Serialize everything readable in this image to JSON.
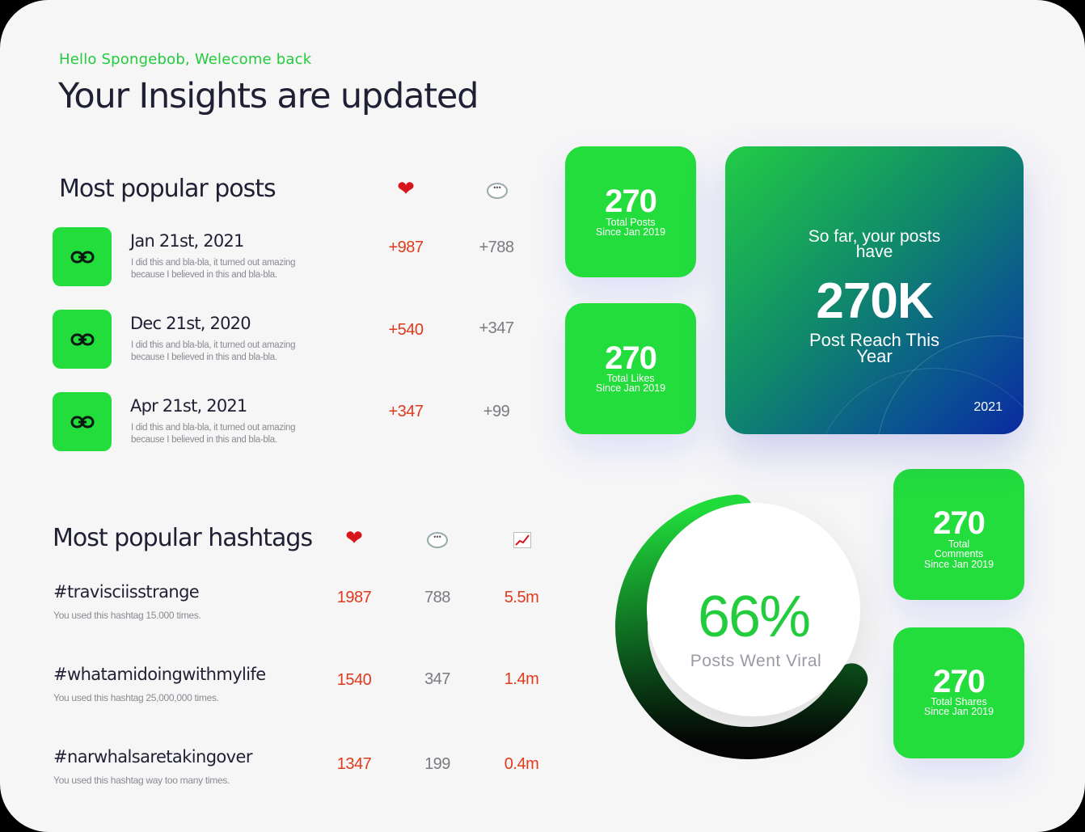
{
  "greeting": "Hello Spongebob, Welecome back",
  "headline": "Your Insights are updated",
  "popular_posts": {
    "title": "Most popular posts",
    "likes_icon": "heart-icon",
    "comments_icon": "speech-bubble-icon",
    "items": [
      {
        "date": "Jan 21st, 2021",
        "desc": "I did this and bla-bla, it turned out amazing because I believed in this and bla-bla.",
        "likes": "+987",
        "comments": "+788"
      },
      {
        "date": "Dec 21st, 2020",
        "desc": "I did this and bla-bla, it turned out amazing because I believed in this and bla-bla.",
        "likes": "+540",
        "comments": "+347"
      },
      {
        "date": "Apr 21st, 2021",
        "desc": "I did this and bla-bla, it turned out amazing because I believed in this and bla-bla.",
        "likes": "+347",
        "comments": "+99"
      }
    ]
  },
  "popular_hashtags": {
    "title": "Most popular hashtags",
    "icons": [
      "heart-icon",
      "speech-bubble-icon",
      "trending-chart-icon"
    ],
    "items": [
      {
        "tag": "#travisciisstrange",
        "desc": "You used this hashtag 15.000 times.",
        "likes": "1987",
        "comments": "788",
        "reach": "5.5m"
      },
      {
        "tag": "#whatamidoingwithmylife",
        "desc": "You used this hashtag 25,000,000 times.",
        "likes": "1540",
        "comments": "347",
        "reach": "1.4m"
      },
      {
        "tag": "#narwhalsaretakingover",
        "desc": "You used this hashtag way too many times.",
        "likes": "1347",
        "comments": "199",
        "reach": "0.4m"
      }
    ]
  },
  "stats": {
    "posts": {
      "value": "270",
      "label1": "Total Posts",
      "label2": "Since Jan 2019"
    },
    "likes": {
      "value": "270",
      "label1": "Total Likes",
      "label2": "Since Jan 2019"
    },
    "comments": {
      "value": "270",
      "label1": "Total",
      "label2": "Comments",
      "label3": "Since Jan 2019"
    },
    "shares": {
      "value": "270",
      "label1": "Total Shares",
      "label2": "Since Jan 2019"
    }
  },
  "reach": {
    "intro1": "So far, your posts",
    "intro2": "have",
    "value": "270K",
    "label1": "Post Reach This",
    "label2": "Year",
    "year": "2021"
  },
  "viral": {
    "percent_text": "66%",
    "percent": 66,
    "label": "Posts Went Viral"
  },
  "colors": {
    "accent_green": "#22dd3c",
    "like_red": "#e0391c",
    "title_dark": "#1f2033"
  }
}
